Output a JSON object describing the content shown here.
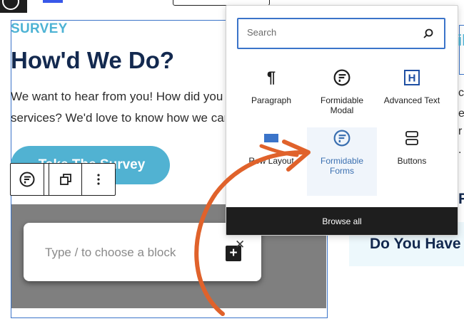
{
  "page": {
    "eyebrow": "SURVEY",
    "title": "How'd We Do?",
    "body_line1": "We want to hear from you! How did you like",
    "body_line2": "services? We'd love to know how we can im",
    "survey_button": "Take The Survey",
    "side_heading": "Do You Have I",
    "side_r": "R",
    "side_top": "il",
    "side_chars": [
      "c",
      "e",
      "r",
      ":",
      "."
    ]
  },
  "appender": {
    "placeholder": "Type / to choose a block",
    "plus": "+",
    "close": "✕"
  },
  "inserter": {
    "search_placeholder": "Search",
    "blocks": [
      {
        "label": "Paragraph",
        "icon": "paragraph-icon"
      },
      {
        "label": "Formidable\nModal",
        "icon": "formidable-logo-icon"
      },
      {
        "label": "Advanced Text",
        "icon": "heading-h-icon"
      },
      {
        "label": "Row Layout",
        "icon": "row-layout-icon"
      },
      {
        "label": "Formidable\nForms",
        "icon": "formidable-logo-icon"
      },
      {
        "label": "Buttons",
        "icon": "buttons-icon"
      }
    ],
    "browse_all": "Browse all"
  },
  "colors": {
    "accent_blue": "#3b74c9",
    "arrow_orange": "#e0622b",
    "navy": "#13294f",
    "light_blue": "#4db3d4"
  }
}
